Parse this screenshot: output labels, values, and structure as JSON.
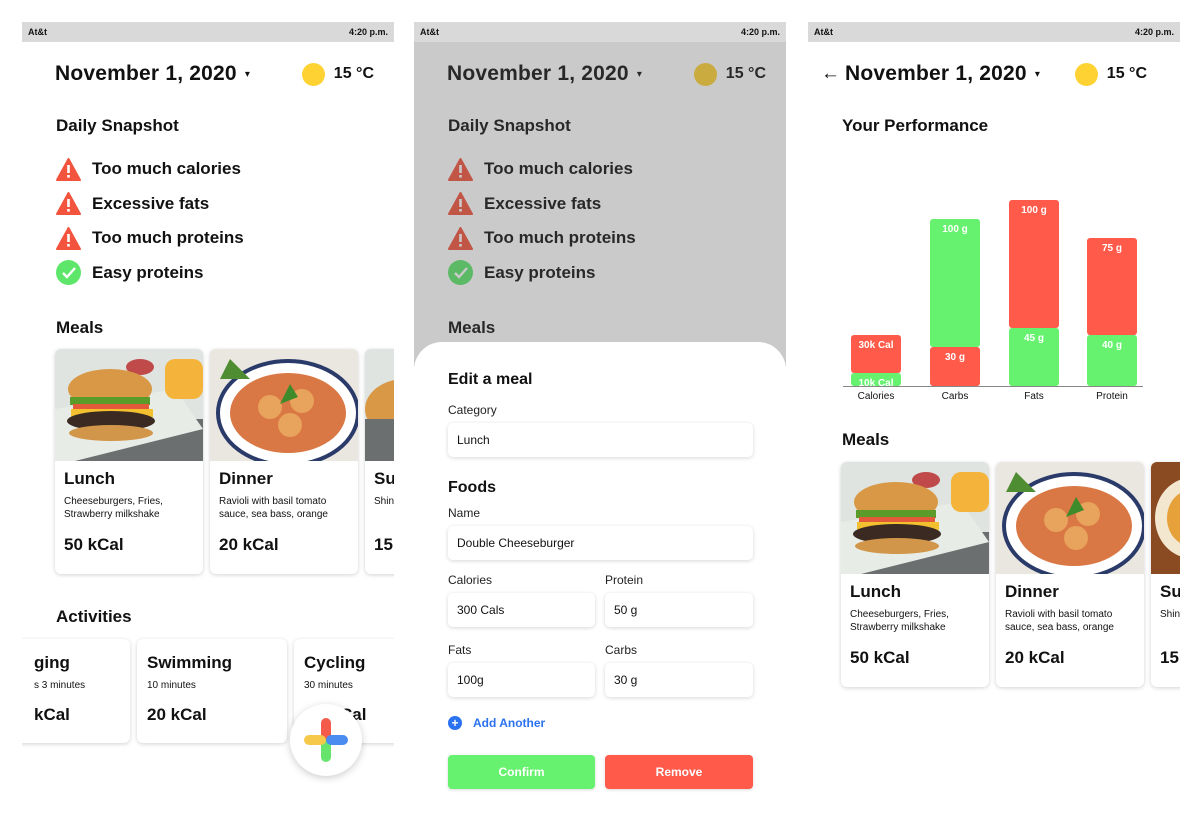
{
  "status": {
    "carrier": "At&t",
    "time": "4:20 p.m."
  },
  "header": {
    "date": "November 1, 2020",
    "caret": "▾",
    "temperature": "15 °C",
    "back_arrow": "←"
  },
  "snapshot": {
    "title": "Daily Snapshot",
    "items": [
      {
        "text": "Too much calories",
        "status": "warning"
      },
      {
        "text": "Excessive fats",
        "status": "warning"
      },
      {
        "text": "Too much proteins",
        "status": "warning"
      },
      {
        "text": "Easy proteins",
        "status": "ok"
      }
    ]
  },
  "meals": {
    "title": "Meals",
    "items": [
      {
        "title": "Lunch",
        "desc": "Cheeseburgers, Fries, Strawberry milkshake",
        "kcal": "50 kCal"
      },
      {
        "title": "Dinner",
        "desc": "Ravioli with basil tomato sauce, sea bass, orange",
        "kcal": "20 kCal"
      },
      {
        "title": "Su",
        "desc": "Shin",
        "kcal": "15"
      }
    ]
  },
  "activities": {
    "title": "Activities",
    "items": [
      {
        "title": "ging",
        "sub": "s 3 minutes",
        "kcal": "kCal"
      },
      {
        "title": "Swimming",
        "sub": "10 minutes",
        "kcal": "20 kCal"
      },
      {
        "title": "Cycling",
        "sub": "30 minutes",
        "kcal": "Cal"
      }
    ]
  },
  "edit_sheet": {
    "title": "Edit a meal",
    "category_label": "Category",
    "category_value": "Lunch",
    "foods_title": "Foods",
    "name_label": "Name",
    "name_value": "Double Cheeseburger",
    "calories_label": "Calories",
    "calories_value": "300 Cals",
    "protein_label": "Protein",
    "protein_value": "50 g",
    "fats_label": "Fats",
    "fats_value": "100g",
    "carbs_label": "Carbs",
    "carbs_value": "30 g",
    "add_another": "Add Another",
    "confirm": "Confirm",
    "remove": "Remove"
  },
  "performance": {
    "title": "Your Performance"
  },
  "colors": {
    "red": "#ff5a4a",
    "green": "#66f26e",
    "accent_blue": "#2a72f0",
    "sun": "#ffd234"
  },
  "chart_data": {
    "type": "bar",
    "stacked": true,
    "categories": [
      "Calories",
      "Carbs",
      "Fats",
      "Protein"
    ],
    "series": [
      {
        "values": [
          10,
          30,
          45,
          40
        ],
        "labels": [
          "10k Cal",
          "30 g",
          "45 g",
          "40 g"
        ],
        "color": "#66f26e"
      },
      {
        "values": [
          30,
          100,
          100,
          75
        ],
        "labels": [
          "30k Cal",
          "100 g",
          "100 g",
          "75 g"
        ]
      }
    ],
    "segment_colors": [
      [
        "#66f26e",
        "#ff5a4a"
      ],
      [
        "#ff5a4a",
        "#66f26e"
      ],
      [
        "#66f26e",
        "#ff5a4a"
      ],
      [
        "#66f26e",
        "#ff5a4a"
      ]
    ],
    "grid": false
  }
}
